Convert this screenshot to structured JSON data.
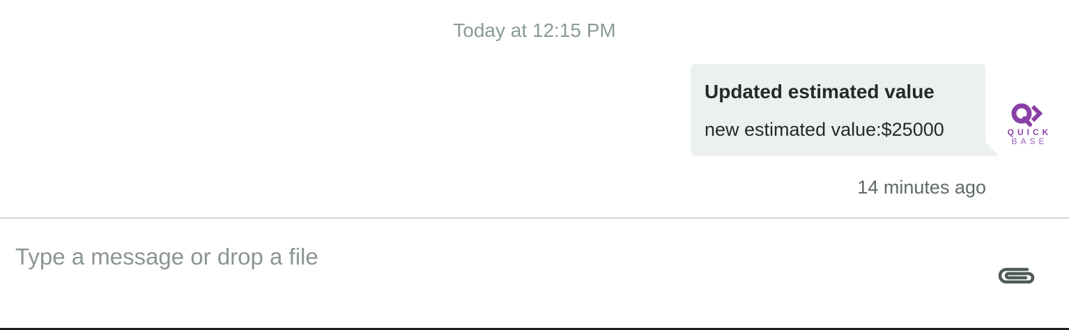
{
  "conversation": {
    "day_separator": "Today at 12:15 PM",
    "message": {
      "title": "Updated estimated value",
      "body": "new estimated value:$25000",
      "timestamp": "14 minutes ago",
      "sender_avatar": {
        "icon": "quickbase-logo-icon",
        "word_top": "QUICK",
        "word_bottom": "BASE",
        "color": "#8a3fa6"
      },
      "bubble_color": "#ecf0f0"
    }
  },
  "composer": {
    "placeholder": "Type a message or drop a file",
    "value": "",
    "attach_icon": "paperclip-icon"
  }
}
